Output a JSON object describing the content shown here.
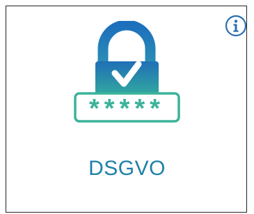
{
  "card": {
    "title": "DSGVO",
    "password_mask": "*****"
  },
  "icons": {
    "info": "info-icon",
    "lock": "padlock-icon",
    "check": "checkmark-icon"
  },
  "colors": {
    "accent_blue": "#1d6fb3",
    "accent_teal": "#3bb39a",
    "title_text": "#1f7fa8",
    "info_ring": "#2a6fb0",
    "border": "#222222",
    "background": "#ffffff"
  }
}
